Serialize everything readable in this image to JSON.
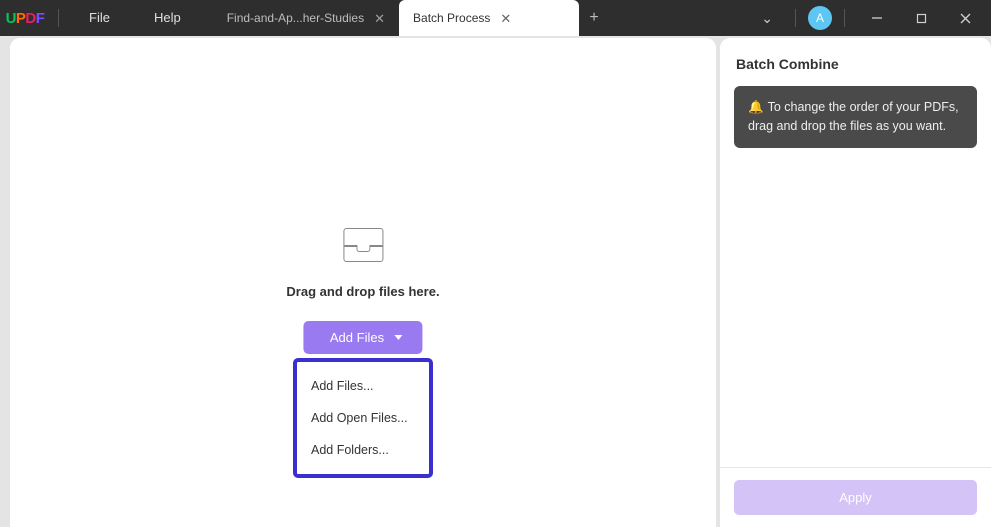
{
  "brand": "UPDF",
  "menu": {
    "file": "File",
    "help": "Help"
  },
  "tabs": [
    {
      "label": "Find-and-Ap...her-Studies",
      "active": false
    },
    {
      "label": "Batch Process",
      "active": true
    }
  ],
  "avatar_letter": "A",
  "dropzone": {
    "text": "Drag and drop files here.",
    "button": "Add Files"
  },
  "dropdown": {
    "items": [
      "Add Files...",
      "Add Open Files...",
      "Add Folders..."
    ]
  },
  "side": {
    "title": "Batch Combine",
    "hint_icon": "🔔",
    "hint": "To change the order of your PDFs, drag and drop the files as you want.",
    "apply": "Apply"
  }
}
